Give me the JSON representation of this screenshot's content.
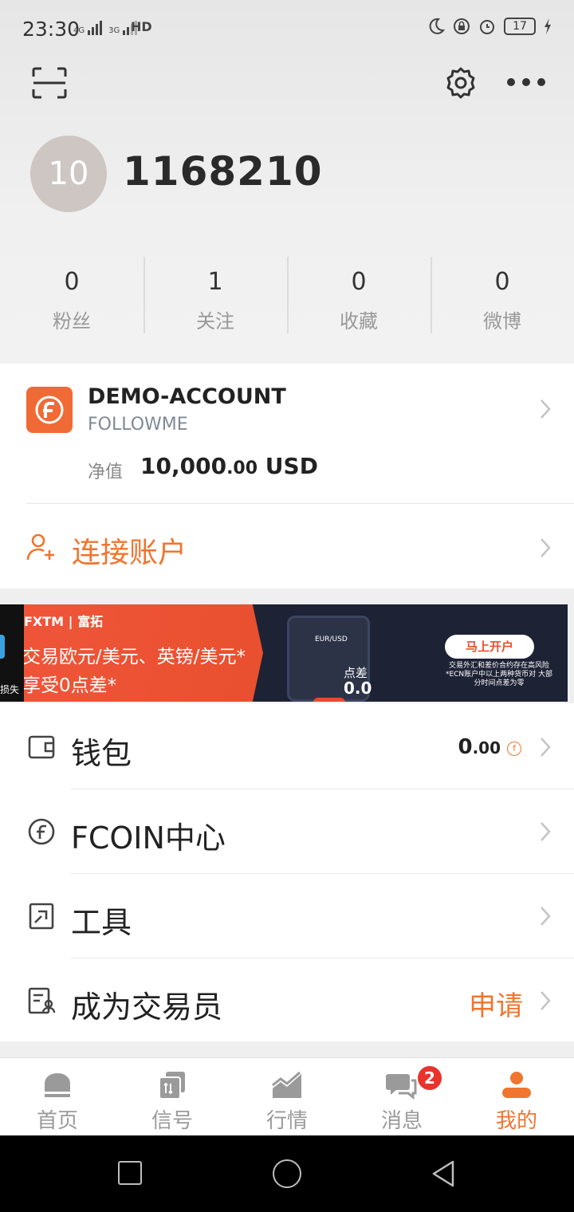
{
  "status_bar": {
    "time": "23:30",
    "network_1": "4G",
    "network_2": "3G",
    "hd": "HD",
    "battery": "17"
  },
  "profile": {
    "avatar_text": "10",
    "user_id": "1168210"
  },
  "stats": [
    {
      "value": "0",
      "label": "粉丝"
    },
    {
      "value": "1",
      "label": "关注"
    },
    {
      "value": "0",
      "label": "收藏"
    },
    {
      "value": "0",
      "label": "微博"
    }
  ],
  "account": {
    "name": "DEMO-ACCOUNT",
    "broker": "FOLLOWME",
    "equity_label": "净值",
    "equity_int": "10,000",
    "equity_dec": ".00",
    "equity_currency": "USD",
    "connect_label": "连接账户"
  },
  "banner": {
    "brand": "FXTM | 富拓",
    "line1": "交易欧元/美元、英镑/美元*",
    "line2": "享受0点差*",
    "pair": "EUR/USD",
    "spread_label": "点差",
    "spread_value": "0.0",
    "open_button": "马上开户",
    "note": "交易外汇和差价合约存在高风险 *ECN账户中以上两种货币对 大部分时间点差为零",
    "left_strip_text": "损失"
  },
  "menu": {
    "wallet_label": "钱包",
    "wallet_value_int": "0",
    "wallet_value_dec": ".00",
    "fcoin_label": "FCOIN中心",
    "tools_label": "工具",
    "trader_label": "成为交易员",
    "trader_action": "申请"
  },
  "tabs": [
    {
      "label": "首页",
      "icon": "home-icon"
    },
    {
      "label": "信号",
      "icon": "signal-icon"
    },
    {
      "label": "行情",
      "icon": "chart-icon"
    },
    {
      "label": "消息",
      "icon": "message-icon",
      "badge": "2"
    },
    {
      "label": "我的",
      "icon": "profile-icon",
      "active": true
    }
  ],
  "colors": {
    "accent": "#f0752e",
    "badge": "#e8332c",
    "logo": "#f06a35"
  }
}
